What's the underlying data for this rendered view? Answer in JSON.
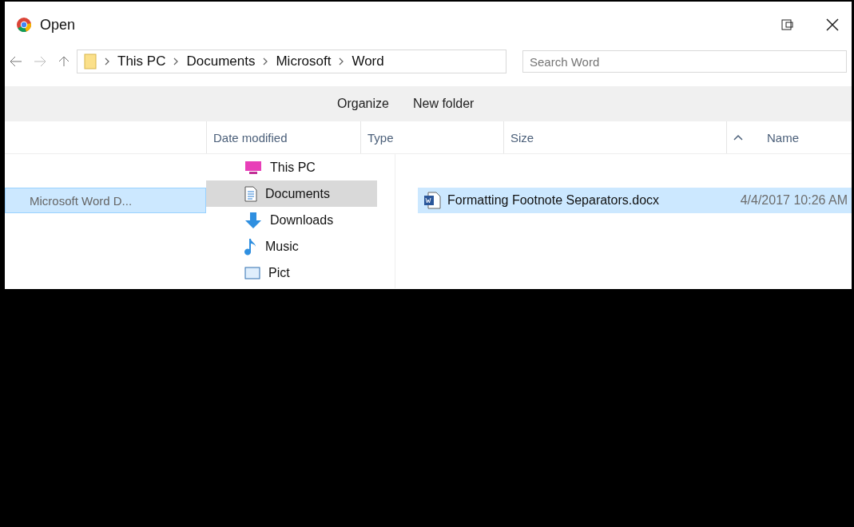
{
  "window": {
    "title": "Open"
  },
  "address_bar": {
    "path": [
      "This PC",
      "Documents",
      "Microsoft",
      "Word"
    ]
  },
  "search": {
    "placeholder": "Search Word"
  },
  "toolbar": {
    "buttons": [
      "Organize",
      "New folder"
    ]
  },
  "columns": [
    "Date modified",
    "Type",
    "Size",
    "Name"
  ],
  "left_pane": {
    "rows": [
      {
        "label": "Microsoft Word D...",
        "selected": true
      }
    ]
  },
  "nav": {
    "items": [
      {
        "label": "This PC",
        "kind": "computer",
        "selected": false
      },
      {
        "label": "Documents",
        "kind": "documents",
        "selected": true
      },
      {
        "label": "Downloads",
        "kind": "downloads",
        "selected": false
      },
      {
        "label": "Music",
        "kind": "music",
        "selected": false
      },
      {
        "label": "Pict",
        "kind": "pictures",
        "selected": false
      }
    ]
  },
  "files": [
    {
      "name": "Formatting Footnote Separators.docx",
      "date": "4/4/2017 10:26 AM",
      "selected": true
    }
  ]
}
